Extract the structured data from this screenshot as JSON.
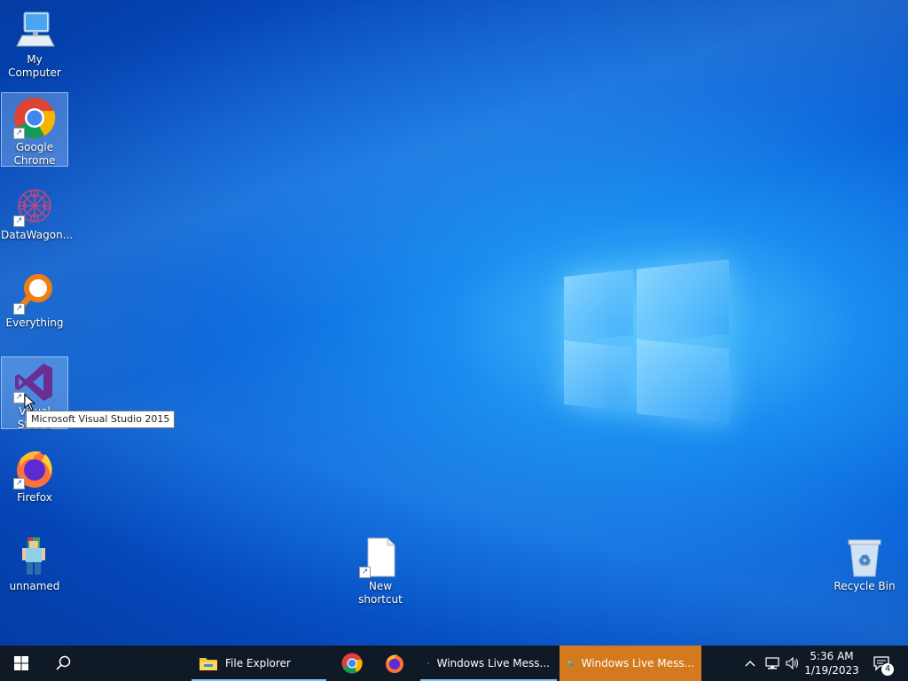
{
  "desktop": {
    "icons": [
      {
        "label": "My Computer"
      },
      {
        "label": "Google Chrome"
      },
      {
        "label": "DataWagon..."
      },
      {
        "label": "Everything"
      },
      {
        "label": "Visual Studio"
      },
      {
        "label": "Firefox"
      },
      {
        "label": "unnamed"
      },
      {
        "label": "New shortcut"
      },
      {
        "label": "Recycle Bin"
      }
    ],
    "tooltip": "Microsoft Visual Studio 2015"
  },
  "taskbar": {
    "apps": [
      {
        "label": "File Explorer"
      },
      {
        "label": "Windows Live Mess..."
      },
      {
        "label": "Windows Live Mess..."
      }
    ],
    "time": "5:36 AM",
    "date": "1/19/2023",
    "notification_count": "4"
  },
  "colors": {
    "taskbar": "#101a26",
    "active_task": "#d47a1e",
    "desktop_blue": "#0a63d8"
  }
}
